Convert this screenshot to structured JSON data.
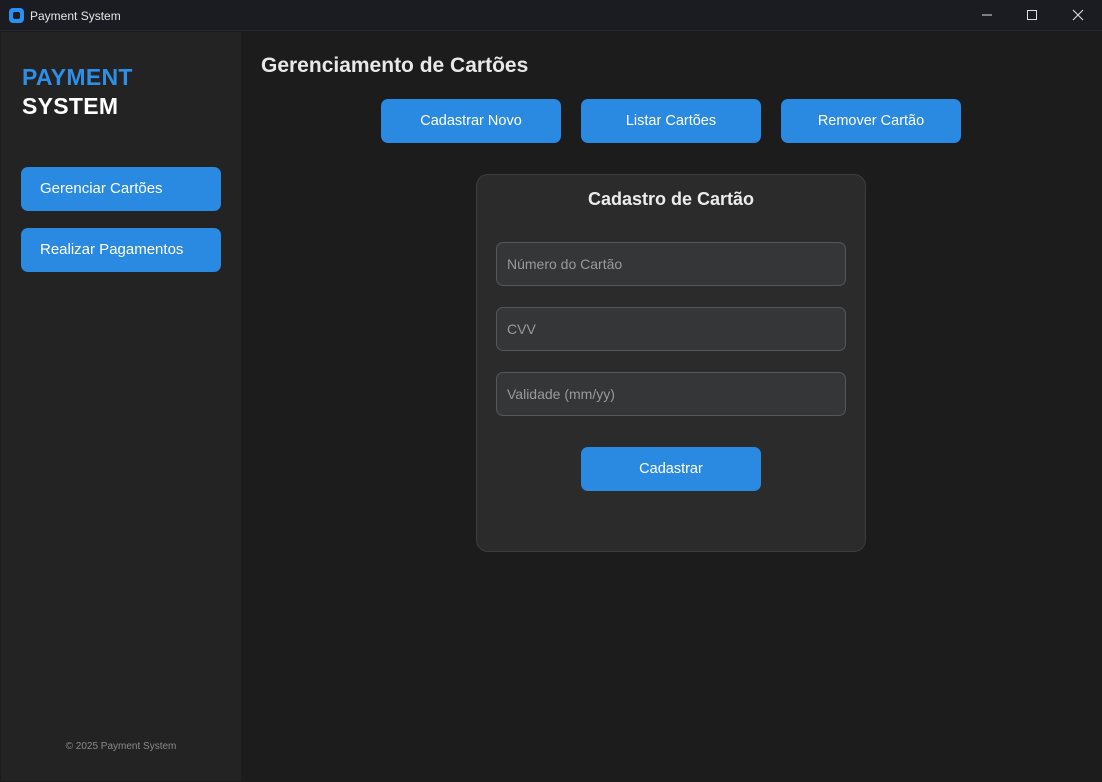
{
  "window": {
    "title": "Payment System",
    "icon": "app-icon"
  },
  "sidebar": {
    "logo_line1": "PAYMENT",
    "logo_line2": "SYSTEM",
    "items": [
      {
        "label": "Gerenciar Cartões"
      },
      {
        "label": "Realizar Pagamentos"
      }
    ],
    "copyright": "© 2025 Payment System"
  },
  "main": {
    "title": "Gerenciamento de Cartões",
    "actions": [
      {
        "label": "Cadastrar Novo"
      },
      {
        "label": "Listar Cartões"
      },
      {
        "label": "Remover Cartão"
      }
    ],
    "form": {
      "title": "Cadastro de Cartão",
      "card_number": {
        "value": "",
        "placeholder": "Número do Cartão"
      },
      "cvv": {
        "value": "",
        "placeholder": "CVV"
      },
      "expiry": {
        "value": "",
        "placeholder": "Validade (mm/yy)"
      },
      "submit_label": "Cadastrar"
    }
  },
  "colors": {
    "accent": "#2a8ae2",
    "logo_accent": "#2f8ee5",
    "background": "#1c1c1c",
    "sidebar": "#232323",
    "card": "#2b2b2b"
  }
}
